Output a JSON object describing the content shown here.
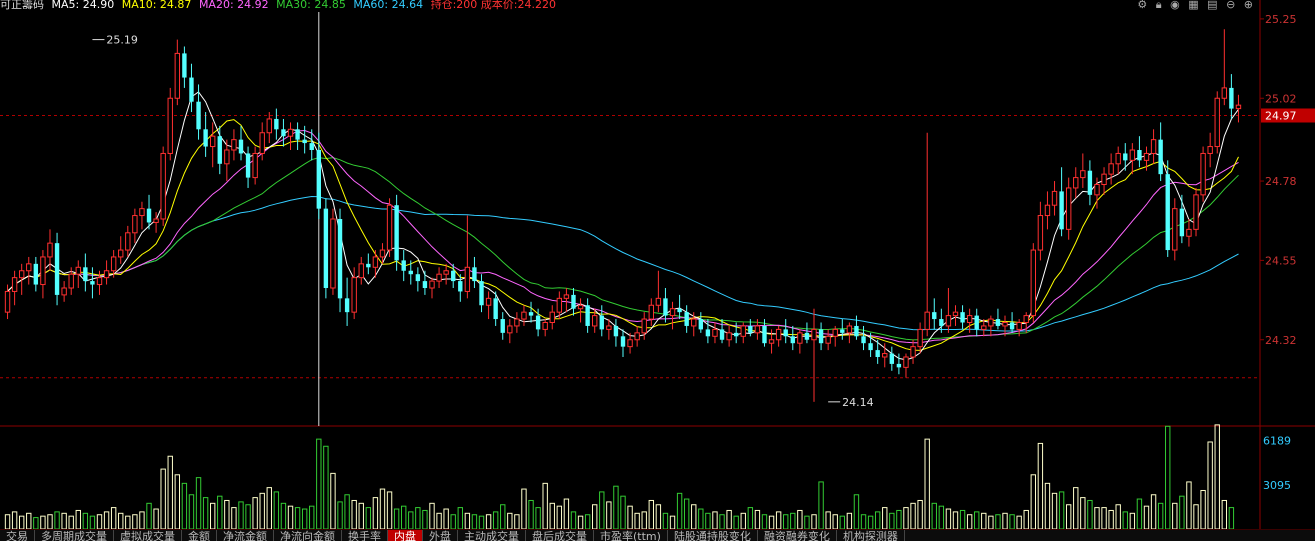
{
  "header": {
    "title": "可正籌码",
    "ma5": "MA5: 24.90",
    "ma10": "MA10: 24.87",
    "ma20": "MA20: 24.92",
    "ma30": "MA30: 24.85",
    "ma60": "MA60: 24.64",
    "position": "持仓:200 成本价:24.220",
    "colors": {
      "ma5": "#ffffff",
      "ma10": "#ffff00",
      "ma20": "#ff66ff",
      "ma30": "#33cc33",
      "ma60": "#33ccff",
      "position": "#ff3333"
    }
  },
  "toolbar_icons": [
    "gear-icon",
    "lock-icon",
    "eye-icon",
    "chart-icon",
    "layers-icon",
    "minus-icon",
    "plus-icon"
  ],
  "bottom_tabs": [
    {
      "label": "交易",
      "active": false
    },
    {
      "label": "多周期成交量",
      "active": false
    },
    {
      "label": "虚拟成交量",
      "active": false
    },
    {
      "label": "金额",
      "active": false
    },
    {
      "label": "净流金额",
      "active": false
    },
    {
      "label": "净流向金额",
      "active": false
    },
    {
      "label": "换手率",
      "active": false
    },
    {
      "label": "内盘",
      "active": true
    },
    {
      "label": "外盘",
      "active": false
    },
    {
      "label": "主动成交量",
      "active": false
    },
    {
      "label": "盘后成交量",
      "active": false
    },
    {
      "label": "市盈率(ttm)",
      "active": false
    },
    {
      "label": "陆股通持股变化",
      "active": false
    },
    {
      "label": "融资融券变化",
      "active": false
    },
    {
      "label": "机构探测器",
      "active": false
    }
  ],
  "chart_data": {
    "type": "candlestick",
    "price_axis": {
      "ticks": [
        25.25,
        25.02,
        24.78,
        24.55,
        24.32
      ],
      "current_price": "24.97",
      "ylim": [
        24.07,
        25.27
      ]
    },
    "volume_axis": {
      "ticks": [
        6189,
        3095
      ],
      "ylim": [
        0,
        6800
      ]
    },
    "annotations": [
      {
        "text": "25.19",
        "price": 25.19,
        "bar": 12
      },
      {
        "text": "24.14",
        "price": 24.14,
        "bar": 116
      }
    ],
    "reference_lines": [
      24.97,
      24.21
    ],
    "crosshair_bar": 44,
    "ohlc": [
      [
        24.4,
        24.48,
        24.38,
        24.46
      ],
      [
        24.46,
        24.52,
        24.42,
        24.5
      ],
      [
        24.5,
        24.54,
        24.45,
        24.52
      ],
      [
        24.52,
        24.56,
        24.48,
        24.54
      ],
      [
        24.54,
        24.56,
        24.46,
        24.48
      ],
      [
        24.48,
        24.58,
        24.44,
        24.56
      ],
      [
        24.56,
        24.64,
        24.52,
        24.6
      ],
      [
        24.6,
        24.63,
        24.42,
        24.45
      ],
      [
        24.45,
        24.49,
        24.43,
        24.47
      ],
      [
        24.47,
        24.53,
        24.45,
        24.51
      ],
      [
        24.51,
        24.55,
        24.47,
        24.53
      ],
      [
        24.53,
        24.57,
        24.46,
        24.49
      ],
      [
        24.49,
        24.53,
        24.44,
        24.48
      ],
      [
        24.48,
        24.52,
        24.45,
        24.5
      ],
      [
        24.5,
        24.55,
        24.48,
        24.52
      ],
      [
        24.52,
        24.58,
        24.5,
        24.56
      ],
      [
        24.56,
        24.62,
        24.54,
        24.58
      ],
      [
        24.58,
        24.65,
        24.56,
        24.63
      ],
      [
        24.63,
        24.7,
        24.6,
        24.68
      ],
      [
        24.68,
        24.72,
        24.64,
        24.7
      ],
      [
        24.7,
        24.74,
        24.64,
        24.66
      ],
      [
        24.66,
        24.69,
        24.63,
        24.67
      ],
      [
        24.67,
        24.88,
        24.65,
        24.86
      ],
      [
        24.86,
        25.05,
        24.84,
        25.02
      ],
      [
        25.02,
        25.19,
        25.0,
        25.15
      ],
      [
        25.15,
        25.17,
        25.05,
        25.08
      ],
      [
        25.08,
        25.12,
        24.98,
        25.01
      ],
      [
        25.01,
        25.06,
        24.9,
        24.93
      ],
      [
        24.93,
        24.98,
        24.85,
        24.88
      ],
      [
        24.88,
        24.95,
        24.82,
        24.91
      ],
      [
        24.91,
        24.94,
        24.8,
        24.83
      ],
      [
        24.83,
        24.9,
        24.78,
        24.87
      ],
      [
        24.87,
        24.93,
        24.84,
        24.9
      ],
      [
        24.9,
        24.94,
        24.84,
        24.86
      ],
      [
        24.86,
        24.88,
        24.76,
        24.79
      ],
      [
        24.79,
        24.88,
        24.77,
        24.86
      ],
      [
        24.86,
        24.95,
        24.84,
        24.92
      ],
      [
        24.92,
        24.98,
        24.89,
        24.96
      ],
      [
        24.96,
        24.99,
        24.9,
        24.93
      ],
      [
        24.93,
        24.96,
        24.88,
        24.91
      ],
      [
        24.91,
        24.95,
        24.87,
        24.93
      ],
      [
        24.93,
        24.95,
        24.87,
        24.9
      ],
      [
        24.9,
        24.94,
        24.86,
        24.89
      ],
      [
        24.89,
        24.93,
        24.84,
        24.87
      ],
      [
        24.87,
        24.92,
        24.67,
        24.7
      ],
      [
        24.7,
        24.73,
        24.44,
        24.47
      ],
      [
        24.47,
        24.7,
        24.45,
        24.67
      ],
      [
        24.67,
        24.7,
        24.4,
        24.44
      ],
      [
        24.44,
        24.5,
        24.36,
        24.4
      ],
      [
        24.4,
        24.53,
        24.38,
        24.5
      ],
      [
        24.5,
        24.56,
        24.48,
        24.54
      ],
      [
        24.54,
        24.57,
        24.51,
        24.53
      ],
      [
        24.53,
        24.58,
        24.5,
        24.56
      ],
      [
        24.56,
        24.6,
        24.54,
        24.58
      ],
      [
        24.58,
        24.73,
        24.56,
        24.71
      ],
      [
        24.71,
        24.74,
        24.52,
        24.55
      ],
      [
        24.55,
        24.58,
        24.49,
        24.52
      ],
      [
        24.52,
        24.55,
        24.48,
        24.51
      ],
      [
        24.51,
        24.53,
        24.46,
        24.49
      ],
      [
        24.49,
        24.52,
        24.45,
        24.47
      ],
      [
        24.47,
        24.5,
        24.44,
        24.49
      ],
      [
        24.49,
        24.53,
        24.47,
        24.51
      ],
      [
        24.51,
        24.54,
        24.48,
        24.52
      ],
      [
        24.52,
        24.54,
        24.47,
        24.49
      ],
      [
        24.49,
        24.51,
        24.43,
        24.46
      ],
      [
        24.46,
        24.68,
        24.44,
        24.53
      ],
      [
        24.53,
        24.56,
        24.47,
        24.49
      ],
      [
        24.49,
        24.51,
        24.4,
        24.42
      ],
      [
        24.42,
        24.46,
        24.38,
        24.44
      ],
      [
        24.44,
        24.46,
        24.36,
        24.38
      ],
      [
        24.38,
        24.4,
        24.32,
        24.34
      ],
      [
        24.34,
        24.38,
        24.31,
        24.36
      ],
      [
        24.36,
        24.4,
        24.34,
        24.38
      ],
      [
        24.38,
        24.42,
        24.36,
        24.4
      ],
      [
        24.4,
        24.43,
        24.37,
        24.39
      ],
      [
        24.39,
        24.41,
        24.33,
        24.35
      ],
      [
        24.35,
        24.38,
        24.33,
        24.37
      ],
      [
        24.37,
        24.42,
        24.35,
        24.4
      ],
      [
        24.4,
        24.46,
        24.38,
        24.44
      ],
      [
        24.44,
        24.47,
        24.4,
        24.45
      ],
      [
        24.45,
        24.47,
        24.39,
        24.41
      ],
      [
        24.41,
        24.44,
        24.37,
        24.42
      ],
      [
        24.42,
        24.44,
        24.34,
        24.36
      ],
      [
        24.36,
        24.41,
        24.34,
        24.39
      ],
      [
        24.39,
        24.42,
        24.33,
        24.35
      ],
      [
        24.35,
        24.38,
        24.32,
        24.36
      ],
      [
        24.36,
        24.38,
        24.3,
        24.33
      ],
      [
        24.33,
        24.35,
        24.27,
        24.3
      ],
      [
        24.3,
        24.34,
        24.28,
        24.32
      ],
      [
        24.32,
        24.36,
        24.3,
        24.34
      ],
      [
        24.34,
        24.4,
        24.32,
        24.38
      ],
      [
        24.38,
        24.44,
        24.36,
        24.42
      ],
      [
        24.42,
        24.52,
        24.4,
        24.44
      ],
      [
        24.44,
        24.47,
        24.37,
        24.39
      ],
      [
        24.39,
        24.43,
        24.35,
        24.41
      ],
      [
        24.41,
        24.45,
        24.38,
        24.4
      ],
      [
        24.4,
        24.42,
        24.34,
        24.36
      ],
      [
        24.36,
        24.4,
        24.33,
        24.38
      ],
      [
        24.38,
        24.4,
        24.34,
        24.35
      ],
      [
        24.35,
        24.38,
        24.31,
        24.33
      ],
      [
        24.33,
        24.37,
        24.31,
        24.35
      ],
      [
        24.35,
        24.38,
        24.31,
        24.32
      ],
      [
        24.32,
        24.36,
        24.3,
        24.34
      ],
      [
        24.34,
        24.37,
        24.31,
        24.33
      ],
      [
        24.33,
        24.37,
        24.31,
        24.36
      ],
      [
        24.36,
        24.38,
        24.33,
        24.34
      ],
      [
        24.34,
        24.38,
        24.32,
        24.36
      ],
      [
        24.36,
        24.38,
        24.3,
        24.31
      ],
      [
        24.31,
        24.35,
        24.28,
        24.32
      ],
      [
        24.32,
        24.36,
        24.3,
        24.35
      ],
      [
        24.35,
        24.38,
        24.31,
        24.33
      ],
      [
        24.33,
        24.36,
        24.29,
        24.31
      ],
      [
        24.31,
        24.35,
        24.28,
        24.34
      ],
      [
        24.34,
        24.37,
        24.31,
        24.32
      ],
      [
        24.32,
        24.41,
        24.14,
        24.35
      ],
      [
        24.35,
        24.37,
        24.29,
        24.31
      ],
      [
        24.31,
        24.35,
        24.29,
        24.33
      ],
      [
        24.33,
        24.36,
        24.3,
        24.35
      ],
      [
        24.35,
        24.38,
        24.32,
        24.34
      ],
      [
        24.34,
        24.37,
        24.31,
        24.36
      ],
      [
        24.36,
        24.39,
        24.32,
        24.33
      ],
      [
        24.33,
        24.36,
        24.29,
        24.31
      ],
      [
        24.31,
        24.34,
        24.27,
        24.29
      ],
      [
        24.29,
        24.32,
        24.25,
        24.27
      ],
      [
        24.27,
        24.31,
        24.24,
        24.28
      ],
      [
        24.28,
        24.3,
        24.23,
        24.25
      ],
      [
        24.25,
        24.28,
        24.22,
        24.24
      ],
      [
        24.24,
        24.28,
        24.21,
        24.27
      ],
      [
        24.27,
        24.32,
        24.25,
        24.3
      ],
      [
        24.3,
        24.37,
        24.28,
        24.35
      ],
      [
        24.35,
        24.92,
        24.33,
        24.4
      ],
      [
        24.4,
        24.44,
        24.35,
        24.38
      ],
      [
        24.38,
        24.41,
        24.34,
        24.36
      ],
      [
        24.36,
        24.47,
        24.34,
        24.39
      ],
      [
        24.39,
        24.42,
        24.36,
        24.4
      ],
      [
        24.4,
        24.42,
        24.35,
        24.37
      ],
      [
        24.37,
        24.41,
        24.34,
        24.39
      ],
      [
        24.39,
        24.41,
        24.33,
        24.35
      ],
      [
        24.35,
        24.38,
        24.33,
        24.36
      ],
      [
        24.36,
        24.39,
        24.33,
        24.38
      ],
      [
        24.38,
        24.41,
        24.35,
        24.36
      ],
      [
        24.36,
        24.39,
        24.33,
        24.37
      ],
      [
        24.37,
        24.4,
        24.34,
        24.35
      ],
      [
        24.35,
        24.38,
        24.33,
        24.37
      ],
      [
        24.37,
        24.4,
        24.34,
        24.39
      ],
      [
        24.39,
        24.6,
        24.37,
        24.58
      ],
      [
        24.58,
        24.72,
        24.55,
        24.68
      ],
      [
        24.68,
        24.75,
        24.64,
        24.71
      ],
      [
        24.71,
        24.78,
        24.68,
        24.75
      ],
      [
        24.75,
        24.82,
        24.62,
        24.64
      ],
      [
        24.64,
        24.79,
        24.61,
        24.76
      ],
      [
        24.76,
        24.82,
        24.73,
        24.79
      ],
      [
        24.79,
        24.86,
        24.76,
        24.81
      ],
      [
        24.81,
        24.84,
        24.71,
        24.74
      ],
      [
        24.74,
        24.79,
        24.7,
        24.77
      ],
      [
        24.77,
        24.82,
        24.74,
        24.8
      ],
      [
        24.8,
        24.86,
        24.77,
        24.83
      ],
      [
        24.83,
        24.88,
        24.8,
        24.86
      ],
      [
        24.86,
        24.89,
        24.81,
        24.84
      ],
      [
        24.84,
        24.89,
        24.8,
        24.87
      ],
      [
        24.87,
        24.91,
        24.82,
        24.84
      ],
      [
        24.84,
        24.88,
        24.81,
        24.86
      ],
      [
        24.86,
        24.93,
        24.83,
        24.9
      ],
      [
        24.9,
        24.95,
        24.78,
        24.8
      ],
      [
        24.8,
        24.84,
        24.56,
        24.58
      ],
      [
        24.58,
        24.73,
        24.55,
        24.7
      ],
      [
        24.7,
        24.74,
        24.6,
        24.62
      ],
      [
        24.62,
        24.67,
        24.59,
        24.64
      ],
      [
        24.64,
        24.76,
        24.62,
        24.74
      ],
      [
        24.74,
        24.88,
        24.72,
        24.86
      ],
      [
        24.86,
        24.92,
        24.82,
        24.88
      ],
      [
        24.88,
        25.04,
        24.86,
        25.02
      ],
      [
        25.02,
        25.22,
        25.0,
        25.05
      ],
      [
        25.05,
        25.09,
        24.96,
        24.99
      ],
      [
        24.99,
        25.03,
        24.95,
        25.0
      ]
    ],
    "volume": [
      1000,
      1200,
      900,
      1100,
      800,
      900,
      1000,
      1200,
      1100,
      900,
      1300,
      1100,
      900,
      1000,
      1200,
      1500,
      1100,
      900,
      1000,
      1200,
      1800,
      1400,
      4200,
      5100,
      3800,
      3200,
      2400,
      3600,
      2200,
      1800,
      2300,
      2000,
      1500,
      1900,
      1700,
      2200,
      2500,
      2900,
      2600,
      1800,
      1600,
      1500,
      1400,
      1600,
      6300,
      5800,
      3900,
      1900,
      2400,
      2000,
      1800,
      1500,
      2200,
      2800,
      2600,
      1400,
      1600,
      1200,
      1500,
      1300,
      1800,
      1100,
      1400,
      1000,
      1500,
      1100,
      1000,
      900,
      1000,
      1200,
      1700,
      1100,
      1000,
      2800,
      2000,
      1500,
      3200,
      1800,
      1600,
      2100,
      1200,
      900,
      1000,
      1700,
      2600,
      1900,
      3000,
      2300,
      1600,
      1100,
      1200,
      2000,
      1700,
      1100,
      900,
      2500,
      2100,
      1700,
      1400,
      1100,
      1200,
      1000,
      1300,
      900,
      1100,
      1500,
      1300,
      1000,
      900,
      1200,
      1000,
      1100,
      1300,
      900,
      1000,
      3300,
      1200,
      1000,
      900,
      1100,
      2400,
      1000,
      900,
      1200,
      1500,
      1100,
      1300,
      1500,
      1800,
      2000,
      6300,
      1800,
      1600,
      1400,
      1200,
      1300,
      1000,
      1200,
      1100,
      900,
      1000,
      1100,
      1000,
      900,
      1300,
      3800,
      6000,
      3200,
      2500,
      2600,
      1700,
      2900,
      2200,
      2000,
      1500,
      1500,
      1300,
      1700,
      1200,
      1100,
      2100,
      1600,
      2400,
      1800,
      7200,
      1800,
      2300,
      3300,
      1700,
      2700,
      6100,
      7300,
      2000,
      1500
    ]
  }
}
